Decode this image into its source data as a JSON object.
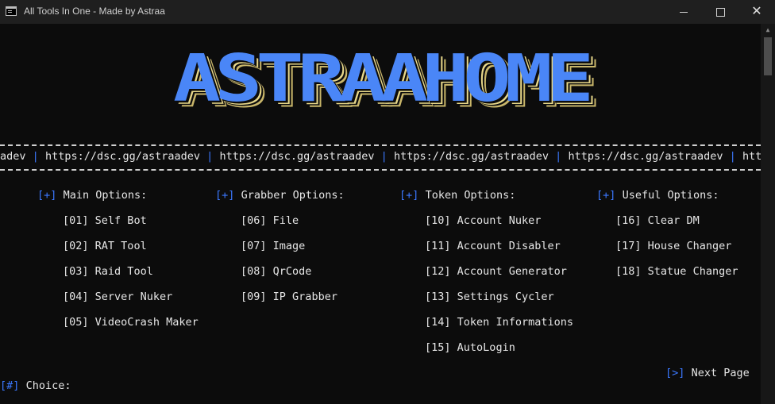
{
  "window": {
    "title": "All Tools In One - Made by Astraa",
    "minimize": "—",
    "maximize": "☐",
    "close": "✕"
  },
  "banner": {
    "text": "ASTRAAHOME"
  },
  "links": {
    "items": [
      "adev",
      "https://dsc.gg/astraadev",
      "https://dsc.gg/astraadev",
      "https://dsc.gg/astraadev",
      "https://dsc.gg/astraadev",
      "https"
    ],
    "separator": "|"
  },
  "sections": [
    {
      "marker": "+",
      "label": "Main Options:",
      "items": [
        {
          "num": "01",
          "label": "Self Bot"
        },
        {
          "num": "02",
          "label": "RAT Tool"
        },
        {
          "num": "03",
          "label": "Raid Tool"
        },
        {
          "num": "04",
          "label": "Server Nuker"
        },
        {
          "num": "05",
          "label": "VideoCrash Maker"
        }
      ]
    },
    {
      "marker": "+",
      "label": "Grabber Options:",
      "items": [
        {
          "num": "06",
          "label": "File"
        },
        {
          "num": "07",
          "label": "Image"
        },
        {
          "num": "08",
          "label": "QrCode"
        },
        {
          "num": "09",
          "label": "IP Grabber"
        }
      ]
    },
    {
      "marker": "+",
      "label": "Token Options:",
      "items": [
        {
          "num": "10",
          "label": "Account Nuker"
        },
        {
          "num": "11",
          "label": "Account Disabler"
        },
        {
          "num": "12",
          "label": "Account Generator"
        },
        {
          "num": "13",
          "label": "Settings Cycler"
        },
        {
          "num": "14",
          "label": "Token Informations"
        },
        {
          "num": "15",
          "label": "AutoLogin"
        }
      ]
    },
    {
      "marker": "+",
      "label": "Useful Options:",
      "items": [
        {
          "num": "16",
          "label": "Clear DM"
        },
        {
          "num": "17",
          "label": "House Changer"
        },
        {
          "num": "18",
          "label": "Statue Changer"
        }
      ]
    }
  ],
  "next_page": {
    "marker": ">",
    "label": "Next Page"
  },
  "prompt": {
    "marker": "#",
    "label": "Choice:"
  },
  "colors": {
    "accent": "#3b78ff",
    "banner": "#4a86f7",
    "banner_shadow": "#e8d88a",
    "background": "#0c0c0c"
  }
}
